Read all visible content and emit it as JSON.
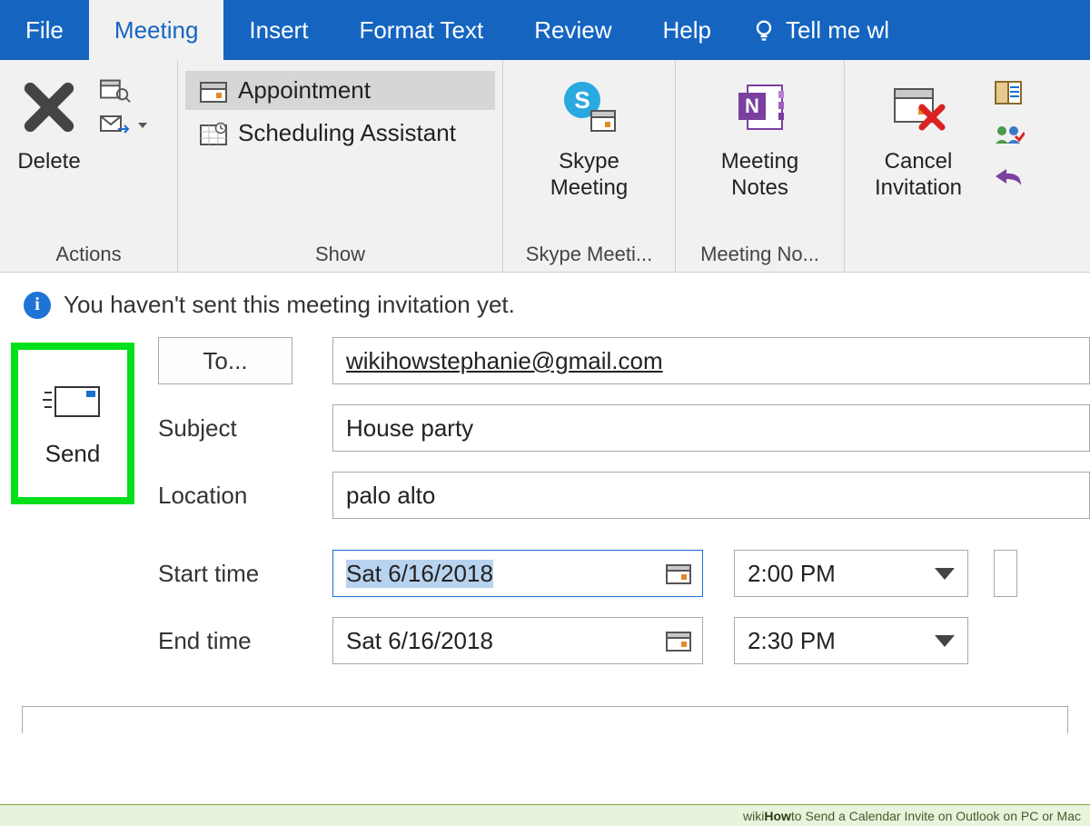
{
  "tabs": {
    "file": "File",
    "meeting": "Meeting",
    "insert": "Insert",
    "format_text": "Format Text",
    "review": "Review",
    "help": "Help",
    "tellme": "Tell me wl"
  },
  "ribbon": {
    "actions": {
      "delete": "Delete",
      "group_label": "Actions"
    },
    "show": {
      "appointment": "Appointment",
      "scheduling": "Scheduling Assistant",
      "group_label": "Show"
    },
    "skype": {
      "button_l1": "Skype",
      "button_l2": "Meeting",
      "group_label": "Skype Meeti..."
    },
    "meeting_notes": {
      "button_l1": "Meeting",
      "button_l2": "Notes",
      "group_label": "Meeting No..."
    },
    "cancel": {
      "button_l1": "Cancel",
      "button_l2": "Invitation"
    }
  },
  "info": {
    "message": "You haven't sent this meeting invitation yet."
  },
  "send": {
    "label": "Send"
  },
  "form": {
    "to_label": "To...",
    "to_value": "wikihowstephanie@gmail.com",
    "subject_label": "Subject",
    "subject_value": "House party",
    "location_label": "Location",
    "location_value": "palo alto",
    "start_label": "Start time",
    "start_date": "Sat 6/16/2018",
    "start_time": "2:00 PM",
    "end_label": "End time",
    "end_date": "Sat 6/16/2018",
    "end_time": "2:30 PM"
  },
  "footer": {
    "wikihow_prefix": "wiki",
    "wikihow_bold": "How",
    "wikihow_suffix": " to Send a Calendar Invite on Outlook on PC or Mac"
  }
}
